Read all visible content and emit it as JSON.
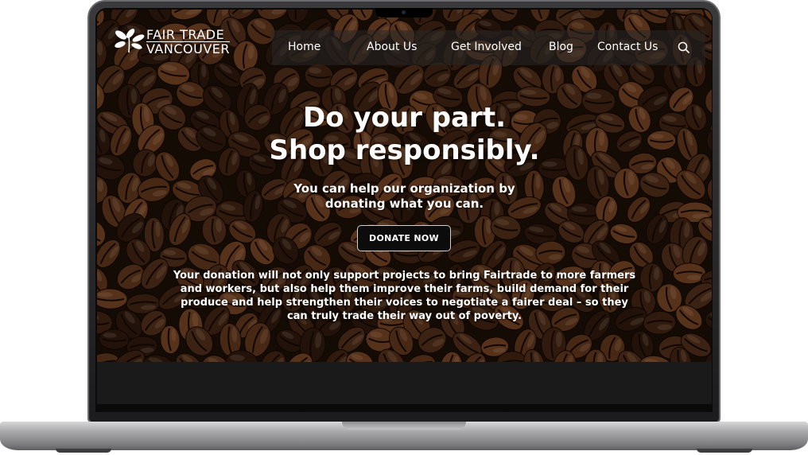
{
  "site": {
    "logo": {
      "line1": "FAIR TRADE",
      "line2": "VANCOUVER",
      "icon": "leaf-icon"
    }
  },
  "nav": {
    "items": [
      {
        "label": "Home"
      },
      {
        "label": "About Us"
      },
      {
        "label": "Get Involved"
      },
      {
        "label": "Blog"
      },
      {
        "label": "Contact Us"
      }
    ],
    "search_icon": "search-icon"
  },
  "hero": {
    "headline_line1": "Do your part.",
    "headline_line2": "Shop responsibly.",
    "subhead_line1": "You can help our organization by",
    "subhead_line2": "donating what you can.",
    "cta_label": "DONATE NOW",
    "body": "Your donation will not only support projects to bring Fairtrade to more farmers and workers, but also help them improve their farms, build demand for their produce and help strengthen their voices to negotiate a fairer deal – so they can truly trade their way out of poverty."
  },
  "colors": {
    "bean_dark": "#2a170c",
    "bean_mid": "#4a2a16",
    "bean_light": "#6b3d21",
    "cta_bg": "#0c0c0c",
    "band": "#1a1a1a"
  }
}
